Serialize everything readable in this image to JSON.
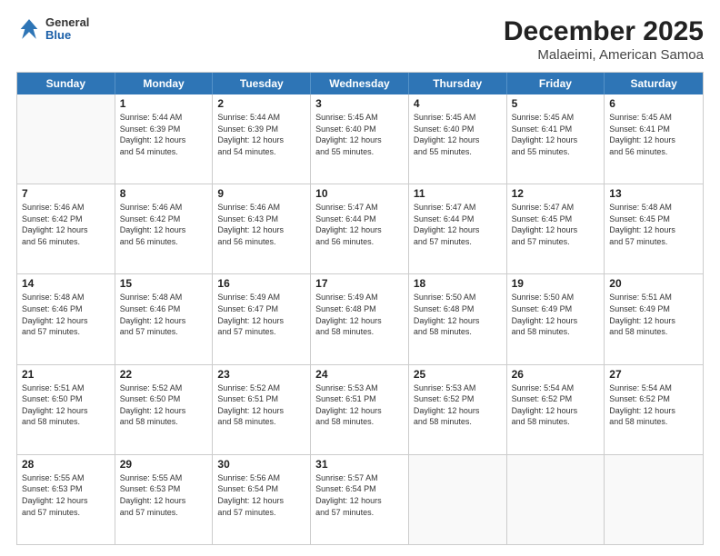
{
  "logo": {
    "general": "General",
    "blue": "Blue"
  },
  "title": "December 2025",
  "subtitle": "Malaeimi, American Samoa",
  "days_of_week": [
    "Sunday",
    "Monday",
    "Tuesday",
    "Wednesday",
    "Thursday",
    "Friday",
    "Saturday"
  ],
  "weeks": [
    [
      {
        "day": "",
        "info": ""
      },
      {
        "day": "1",
        "info": "Sunrise: 5:44 AM\nSunset: 6:39 PM\nDaylight: 12 hours\nand 54 minutes."
      },
      {
        "day": "2",
        "info": "Sunrise: 5:44 AM\nSunset: 6:39 PM\nDaylight: 12 hours\nand 54 minutes."
      },
      {
        "day": "3",
        "info": "Sunrise: 5:45 AM\nSunset: 6:40 PM\nDaylight: 12 hours\nand 55 minutes."
      },
      {
        "day": "4",
        "info": "Sunrise: 5:45 AM\nSunset: 6:40 PM\nDaylight: 12 hours\nand 55 minutes."
      },
      {
        "day": "5",
        "info": "Sunrise: 5:45 AM\nSunset: 6:41 PM\nDaylight: 12 hours\nand 55 minutes."
      },
      {
        "day": "6",
        "info": "Sunrise: 5:45 AM\nSunset: 6:41 PM\nDaylight: 12 hours\nand 56 minutes."
      }
    ],
    [
      {
        "day": "7",
        "info": "Sunrise: 5:46 AM\nSunset: 6:42 PM\nDaylight: 12 hours\nand 56 minutes."
      },
      {
        "day": "8",
        "info": "Sunrise: 5:46 AM\nSunset: 6:42 PM\nDaylight: 12 hours\nand 56 minutes."
      },
      {
        "day": "9",
        "info": "Sunrise: 5:46 AM\nSunset: 6:43 PM\nDaylight: 12 hours\nand 56 minutes."
      },
      {
        "day": "10",
        "info": "Sunrise: 5:47 AM\nSunset: 6:44 PM\nDaylight: 12 hours\nand 56 minutes."
      },
      {
        "day": "11",
        "info": "Sunrise: 5:47 AM\nSunset: 6:44 PM\nDaylight: 12 hours\nand 57 minutes."
      },
      {
        "day": "12",
        "info": "Sunrise: 5:47 AM\nSunset: 6:45 PM\nDaylight: 12 hours\nand 57 minutes."
      },
      {
        "day": "13",
        "info": "Sunrise: 5:48 AM\nSunset: 6:45 PM\nDaylight: 12 hours\nand 57 minutes."
      }
    ],
    [
      {
        "day": "14",
        "info": "Sunrise: 5:48 AM\nSunset: 6:46 PM\nDaylight: 12 hours\nand 57 minutes."
      },
      {
        "day": "15",
        "info": "Sunrise: 5:48 AM\nSunset: 6:46 PM\nDaylight: 12 hours\nand 57 minutes."
      },
      {
        "day": "16",
        "info": "Sunrise: 5:49 AM\nSunset: 6:47 PM\nDaylight: 12 hours\nand 57 minutes."
      },
      {
        "day": "17",
        "info": "Sunrise: 5:49 AM\nSunset: 6:48 PM\nDaylight: 12 hours\nand 58 minutes."
      },
      {
        "day": "18",
        "info": "Sunrise: 5:50 AM\nSunset: 6:48 PM\nDaylight: 12 hours\nand 58 minutes."
      },
      {
        "day": "19",
        "info": "Sunrise: 5:50 AM\nSunset: 6:49 PM\nDaylight: 12 hours\nand 58 minutes."
      },
      {
        "day": "20",
        "info": "Sunrise: 5:51 AM\nSunset: 6:49 PM\nDaylight: 12 hours\nand 58 minutes."
      }
    ],
    [
      {
        "day": "21",
        "info": "Sunrise: 5:51 AM\nSunset: 6:50 PM\nDaylight: 12 hours\nand 58 minutes."
      },
      {
        "day": "22",
        "info": "Sunrise: 5:52 AM\nSunset: 6:50 PM\nDaylight: 12 hours\nand 58 minutes."
      },
      {
        "day": "23",
        "info": "Sunrise: 5:52 AM\nSunset: 6:51 PM\nDaylight: 12 hours\nand 58 minutes."
      },
      {
        "day": "24",
        "info": "Sunrise: 5:53 AM\nSunset: 6:51 PM\nDaylight: 12 hours\nand 58 minutes."
      },
      {
        "day": "25",
        "info": "Sunrise: 5:53 AM\nSunset: 6:52 PM\nDaylight: 12 hours\nand 58 minutes."
      },
      {
        "day": "26",
        "info": "Sunrise: 5:54 AM\nSunset: 6:52 PM\nDaylight: 12 hours\nand 58 minutes."
      },
      {
        "day": "27",
        "info": "Sunrise: 5:54 AM\nSunset: 6:52 PM\nDaylight: 12 hours\nand 58 minutes."
      }
    ],
    [
      {
        "day": "28",
        "info": "Sunrise: 5:55 AM\nSunset: 6:53 PM\nDaylight: 12 hours\nand 57 minutes."
      },
      {
        "day": "29",
        "info": "Sunrise: 5:55 AM\nSunset: 6:53 PM\nDaylight: 12 hours\nand 57 minutes."
      },
      {
        "day": "30",
        "info": "Sunrise: 5:56 AM\nSunset: 6:54 PM\nDaylight: 12 hours\nand 57 minutes."
      },
      {
        "day": "31",
        "info": "Sunrise: 5:57 AM\nSunset: 6:54 PM\nDaylight: 12 hours\nand 57 minutes."
      },
      {
        "day": "",
        "info": ""
      },
      {
        "day": "",
        "info": ""
      },
      {
        "day": "",
        "info": ""
      }
    ]
  ]
}
